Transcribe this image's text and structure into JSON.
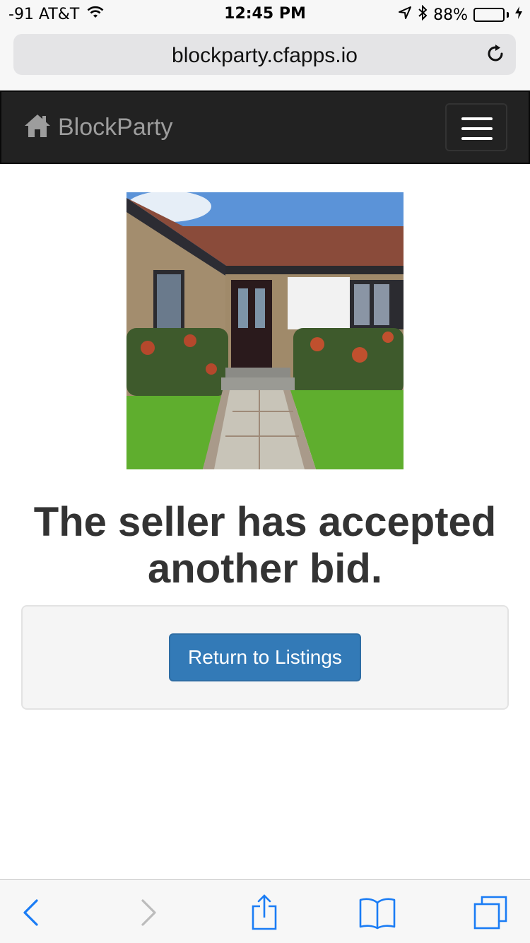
{
  "status_bar": {
    "carrier": "-91 AT&T",
    "time": "12:45 PM",
    "battery": "88%",
    "battery_level": 0.88,
    "icons": [
      "wifi-icon",
      "location-icon",
      "bluetooth-icon",
      "battery-icon",
      "charging-icon"
    ]
  },
  "browser": {
    "url": "blockparty.cfapps.io",
    "reload_icon": "reload-icon"
  },
  "navbar": {
    "brand": "BlockParty",
    "brand_icon": "home-icon",
    "menu_icon": "hamburger-menu-icon"
  },
  "main": {
    "image": "house-photo",
    "headline": "The seller has accepted another bid.",
    "button_label": "Return to Listings",
    "button_color": "#337ab7"
  },
  "toolbar": {
    "items": [
      "back-icon",
      "forward-icon",
      "share-icon",
      "bookmarks-icon",
      "tabs-icon"
    ],
    "accent_color": "#1a7cf5"
  }
}
